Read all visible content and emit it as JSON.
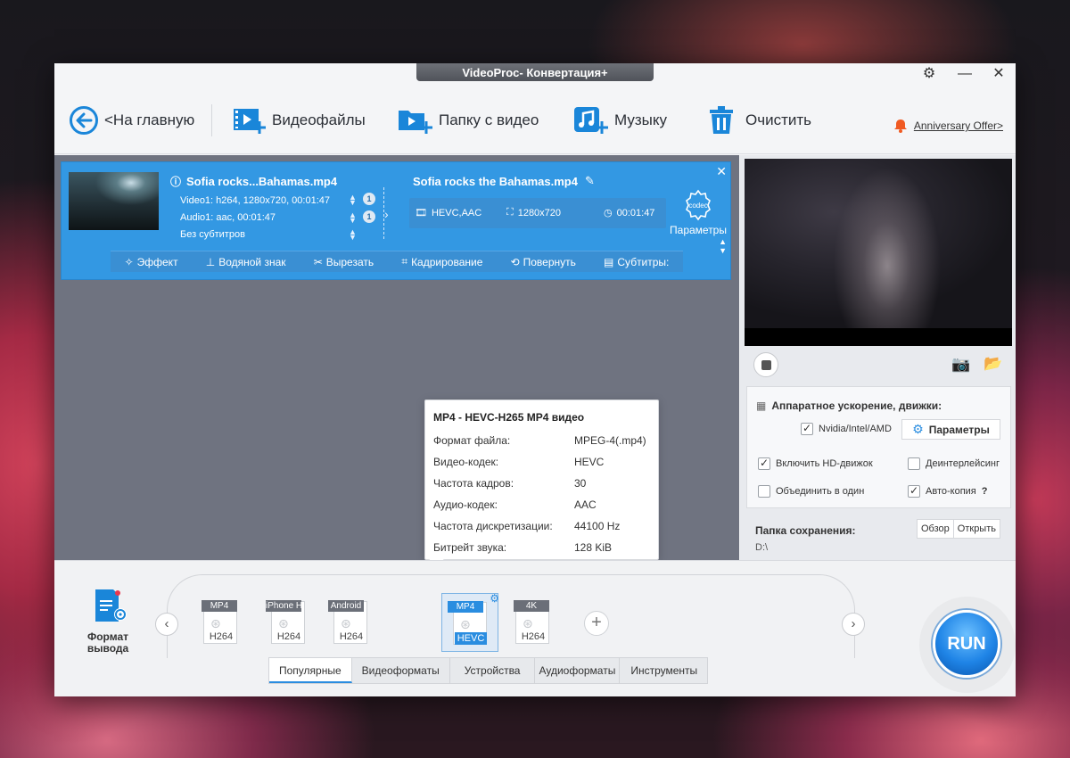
{
  "window": {
    "title": "VideoProc- Конвертация+"
  },
  "toolbar": {
    "home": "<На главную",
    "video_files": "Видеофайлы",
    "video_folder": "Папку с видео",
    "music": "Музыку",
    "clear": "Очистить",
    "offer": "Anniversary Offer>"
  },
  "task": {
    "source_name": "Sofia rocks...Bahamas.mp4",
    "video_info": "Video1: h264, 1280x720, 00:01:47",
    "audio_info": "Audio1: aac, 00:01:47",
    "subtitle_info": "Без субтитров",
    "video_track_num": "1",
    "audio_track_num": "1",
    "output_name": "Sofia rocks the Bahamas.mp4",
    "output_codec": "HEVC,AAC",
    "output_resolution": "1280x720",
    "output_duration": "00:01:47",
    "codec_label": "Параметры",
    "codec_icon_text": "codec",
    "edit": {
      "effect": "Эффект",
      "watermark": "Водяной знак",
      "cut": "Вырезать",
      "crop": "Кадрирование",
      "rotate": "Повернуть",
      "subtitles": "Субтитры:"
    }
  },
  "tooltip": {
    "title": "MP4 - HEVC-H265 MP4 видео",
    "rows": [
      {
        "k": "Формат файла:",
        "v": "MPEG-4(.mp4)"
      },
      {
        "k": "Видео-кодек:",
        "v": "HEVC"
      },
      {
        "k": "Частота кадров:",
        "v": "30"
      },
      {
        "k": "Аудио-кодек:",
        "v": "AAC"
      },
      {
        "k": "Частота дискретизации:",
        "v": "44100 Hz"
      },
      {
        "k": "Битрейт звука:",
        "v": "128 KiB"
      }
    ]
  },
  "side": {
    "hw_title": "Аппаратное ускорение, движки:",
    "nvidia": "Nvidia/Intel/AMD",
    "params_btn": "Параметры",
    "hd_engine": "Включить HD-движок",
    "deinterlace": "Деинтерлейсинг",
    "merge": "Объединить в один",
    "autocopy": "Авто-копия",
    "help": "?",
    "save_label": "Папка сохранения:",
    "save_path": "D:\\",
    "browse": "Обзор",
    "open": "Открыть"
  },
  "bottom": {
    "output_format": "Формат вывода",
    "formats": [
      {
        "tag": "MP4",
        "sub": "H264"
      },
      {
        "tag": "iPhone H",
        "sub": "H264"
      },
      {
        "tag": "Android",
        "sub": "H264"
      },
      {
        "tag": "MP4",
        "sub": "HEVC"
      },
      {
        "tag": "4K",
        "sub": "H264"
      }
    ],
    "tabs": [
      "Популярные",
      "Видеоформаты",
      "Устройства",
      "Аудиоформаты",
      "Инструменты"
    ],
    "run": "RUN"
  },
  "colors": {
    "accent": "#3398e3",
    "offer_bell": "#f05a22"
  }
}
